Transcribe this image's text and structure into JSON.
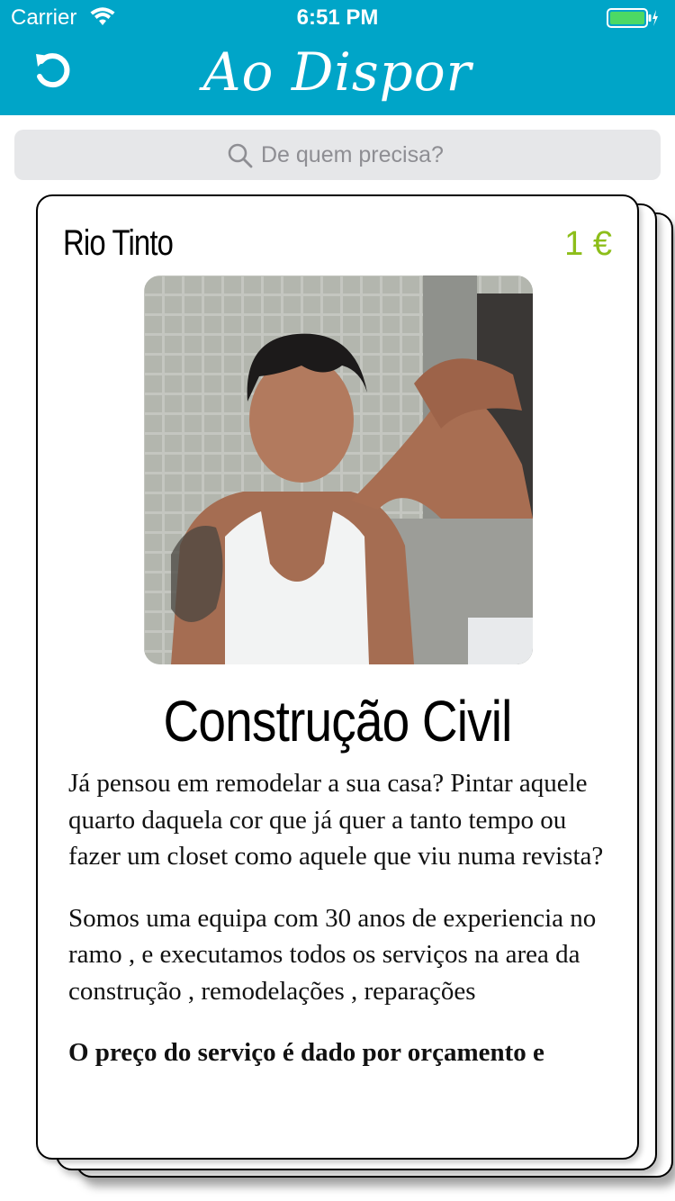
{
  "status_bar": {
    "carrier": "Carrier",
    "time": "6:51 PM"
  },
  "header": {
    "title": "Ao Dispor",
    "color": "#00A5C8"
  },
  "search": {
    "placeholder": "De quem precisa?"
  },
  "card": {
    "location": "Rio Tinto",
    "price": "1 €",
    "price_color": "#8DBE1A",
    "title": "Construção Civil",
    "paragraphs": [
      "Já pensou em remodelar a sua casa? Pintar aquele quarto daquela cor que já quer a tanto tempo ou fazer um closet como aquele que viu numa revista?",
      "Somos uma equipa com 30 anos de experiencia no ramo , e executamos todos os serviços na area da construção , remodelações , reparações",
      "O preço do serviço é dado por orçamento e"
    ]
  },
  "icons": [
    "wifi-icon",
    "battery-icon",
    "refresh-icon",
    "search-icon"
  ]
}
